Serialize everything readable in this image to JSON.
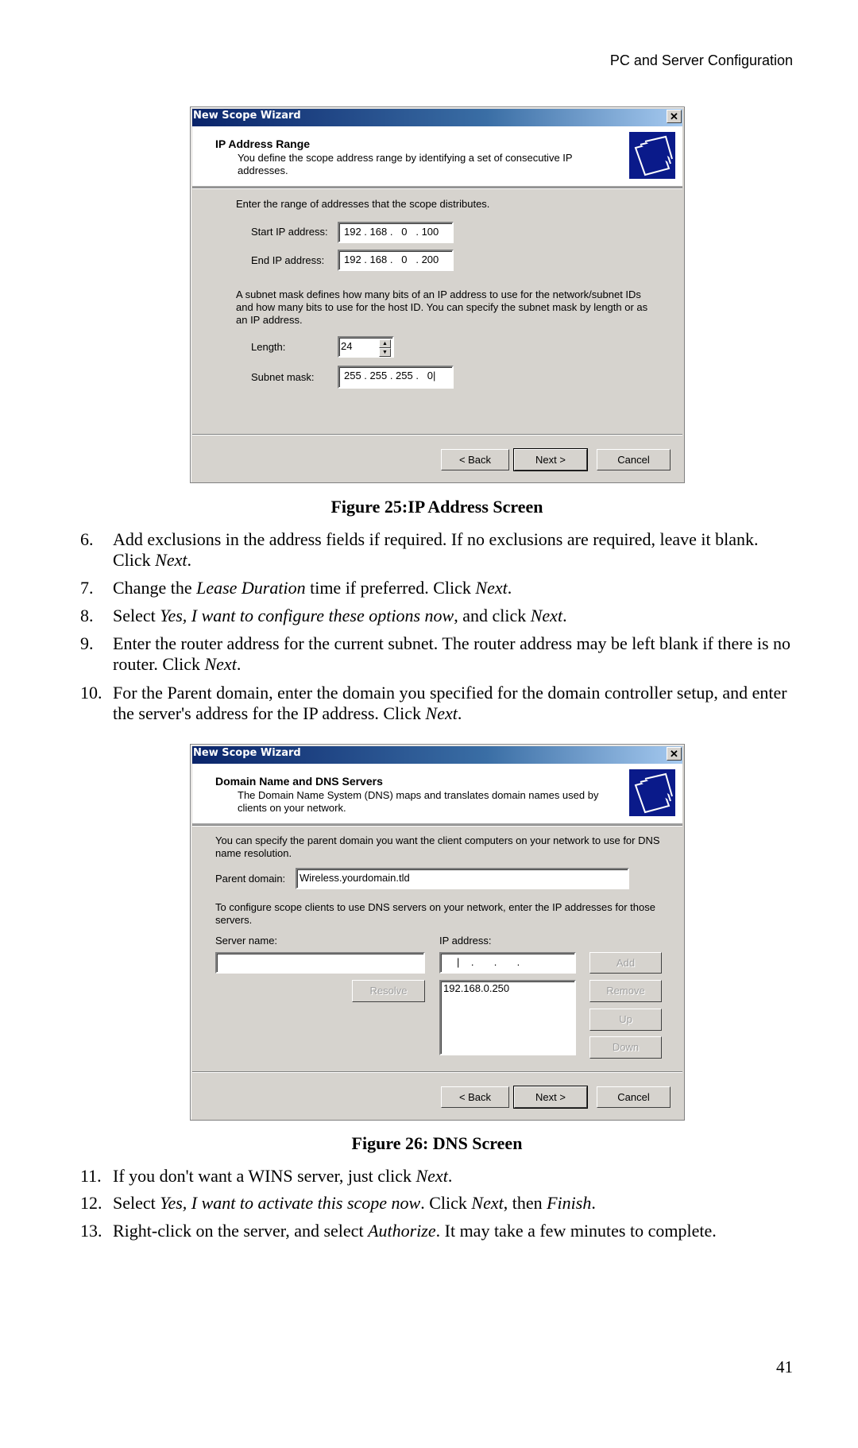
{
  "page_header": "PC and Server Configuration",
  "page_number": "41",
  "figure25": {
    "caption": "Figure 25:IP Address Screen",
    "window_title": "New Scope Wizard",
    "heading": "IP Address Range",
    "description": "You define the scope address range by identifying a set of consecutive IP addresses.",
    "range_intro": "Enter the range of addresses that the scope distributes.",
    "start_label": "Start IP address:",
    "start_value": "192 . 168 .   0   . 100",
    "end_label": "End IP address:",
    "end_value": "192 . 168 .   0   . 200",
    "subnet_text": "A subnet mask defines how many bits of an IP address to use for the network/subnet IDs and how many bits to use for the host ID. You can specify the subnet mask by length or as an IP address.",
    "length_label": "Length:",
    "length_value": "24",
    "mask_label": "Subnet mask:",
    "mask_value": "255 . 255 . 255 .   0|",
    "back": "< Back",
    "next": "Next >",
    "cancel": "Cancel"
  },
  "steps_a": [
    {
      "num": "6.",
      "parts": [
        "Add exclusions in the address fields if required. If no exclusions are required, leave it blank. Click ",
        "Next",
        "."
      ]
    },
    {
      "num": "7.",
      "parts": [
        "Change the ",
        "Lease Duration",
        " time if preferred. Click ",
        "Next",
        "."
      ]
    },
    {
      "num": "8.",
      "parts": [
        "Select ",
        "Yes, I want to configure these options now",
        ", and click ",
        "Next",
        "."
      ]
    },
    {
      "num": "9.",
      "parts": [
        "Enter the router address for the current subnet. The router address may be left blank if there is no router. Click ",
        "Next",
        "."
      ]
    },
    {
      "num": "10.",
      "parts": [
        "For the Parent domain, enter the domain you specified for the domain controller setup, and enter the server's address for the IP address. Click ",
        "Next",
        "."
      ]
    }
  ],
  "figure26": {
    "caption": "Figure 26: DNS Screen",
    "window_title": "New Scope Wizard",
    "heading": "Domain Name and DNS Servers",
    "description": "The Domain Name System (DNS) maps and translates domain names used by clients on your network.",
    "parent_intro": "You can specify the parent domain you want the client computers on your network to use for DNS name resolution.",
    "parent_label": "Parent domain:",
    "parent_value": "Wireless.yourdomain.tld",
    "dns_intro": "To configure scope clients to use DNS servers on your network, enter the IP addresses for those servers.",
    "server_label": "Server name:",
    "ip_label": "IP address:",
    "ip_input_value": "|    .       .       .",
    "ip_list": [
      "192.168.0.250"
    ],
    "add": "Add",
    "resolve": "Resolve",
    "remove": "Remove",
    "up": "Up",
    "down": "Down",
    "back": "< Back",
    "next": "Next >",
    "cancel": "Cancel"
  },
  "steps_b": [
    {
      "num": "11.",
      "parts": [
        "If you don't want a WINS server, just click ",
        "Next",
        "."
      ]
    },
    {
      "num": "12.",
      "parts": [
        "Select ",
        "Yes, I want to activate this scope now",
        ". Click ",
        "Next",
        ", then ",
        "Finish",
        "."
      ]
    },
    {
      "num": "13.",
      "parts": [
        "Right-click on the server, and select ",
        "Authorize",
        ". It may take a few minutes to complete."
      ]
    }
  ]
}
